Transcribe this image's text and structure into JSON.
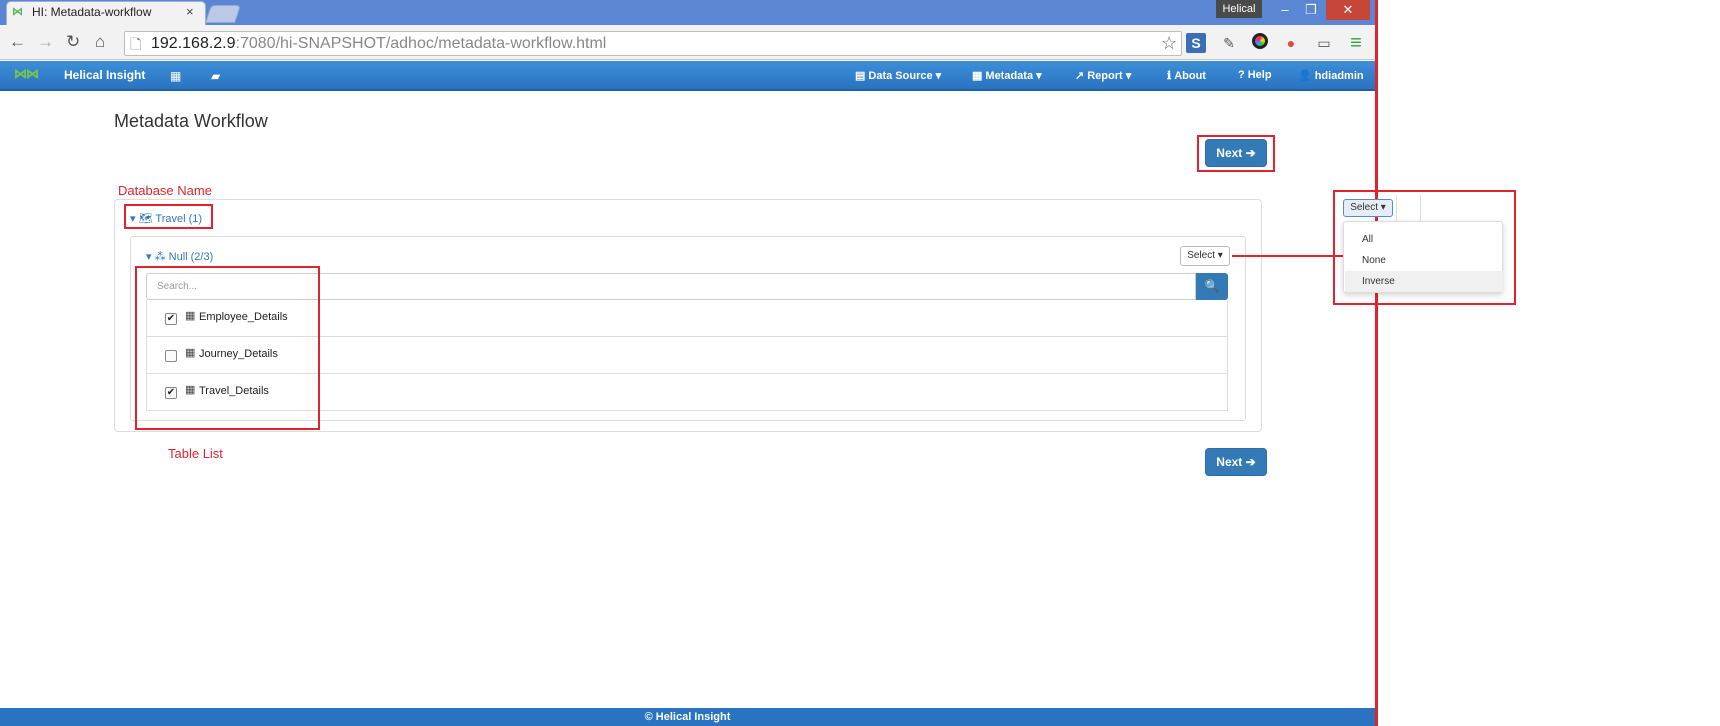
{
  "browser": {
    "tab_title": "HI: Metadata-workflow",
    "tab_close": "×",
    "profile_name": "Helical",
    "win_min": "–",
    "win_max": "❐",
    "win_close": "✕",
    "url_host": "192.168.2.9",
    "url_rest": ":7080/hi-SNAPSHOT/adhoc/metadata-workflow.html",
    "back_icon": "←",
    "forward_icon": "→",
    "reload_icon": "↻",
    "home_icon": "⌂",
    "page_icon": "🗋",
    "star_icon": "☆",
    "menu_icon": "≡"
  },
  "navbar": {
    "brand": "Helical Insight",
    "items": [
      {
        "icon": "▤",
        "label": "Data Source ▾"
      },
      {
        "icon": "▦",
        "label": "Metadata ▾"
      },
      {
        "icon": "↗",
        "label": "Report ▾"
      },
      {
        "icon": "ℹ",
        "label": "About"
      },
      {
        "icon": "?",
        "label": "Help"
      },
      {
        "icon": "👤",
        "label": "hdiadmin"
      }
    ]
  },
  "page": {
    "title": "Metadata Workflow",
    "next_label": "Next ➔",
    "database_name_annotation": "Database Name",
    "table_list_annotation": "Table List",
    "database": {
      "toggle": "▾ 🗺 Travel (1)"
    },
    "schema": {
      "toggle": "▾ ⁂ Null (2/3)",
      "select_label": "Select ▾"
    },
    "search": {
      "placeholder": "Search...",
      "button_icon": "🔍"
    },
    "tables": [
      {
        "name": "Employee_Details",
        "checked": true
      },
      {
        "name": "Journey_Details",
        "checked": false
      },
      {
        "name": "Travel_Details",
        "checked": true
      }
    ]
  },
  "zoomed_dropdown": {
    "select_label": "Select ▾",
    "options": [
      "All",
      "None",
      "Inverse"
    ],
    "highlighted": "Inverse"
  },
  "footer": {
    "text": "© Helical Insight"
  },
  "colors": {
    "accent": "#337ab7",
    "annotation_red": "#e0232e",
    "navbar_blue": "#2a73c0"
  }
}
